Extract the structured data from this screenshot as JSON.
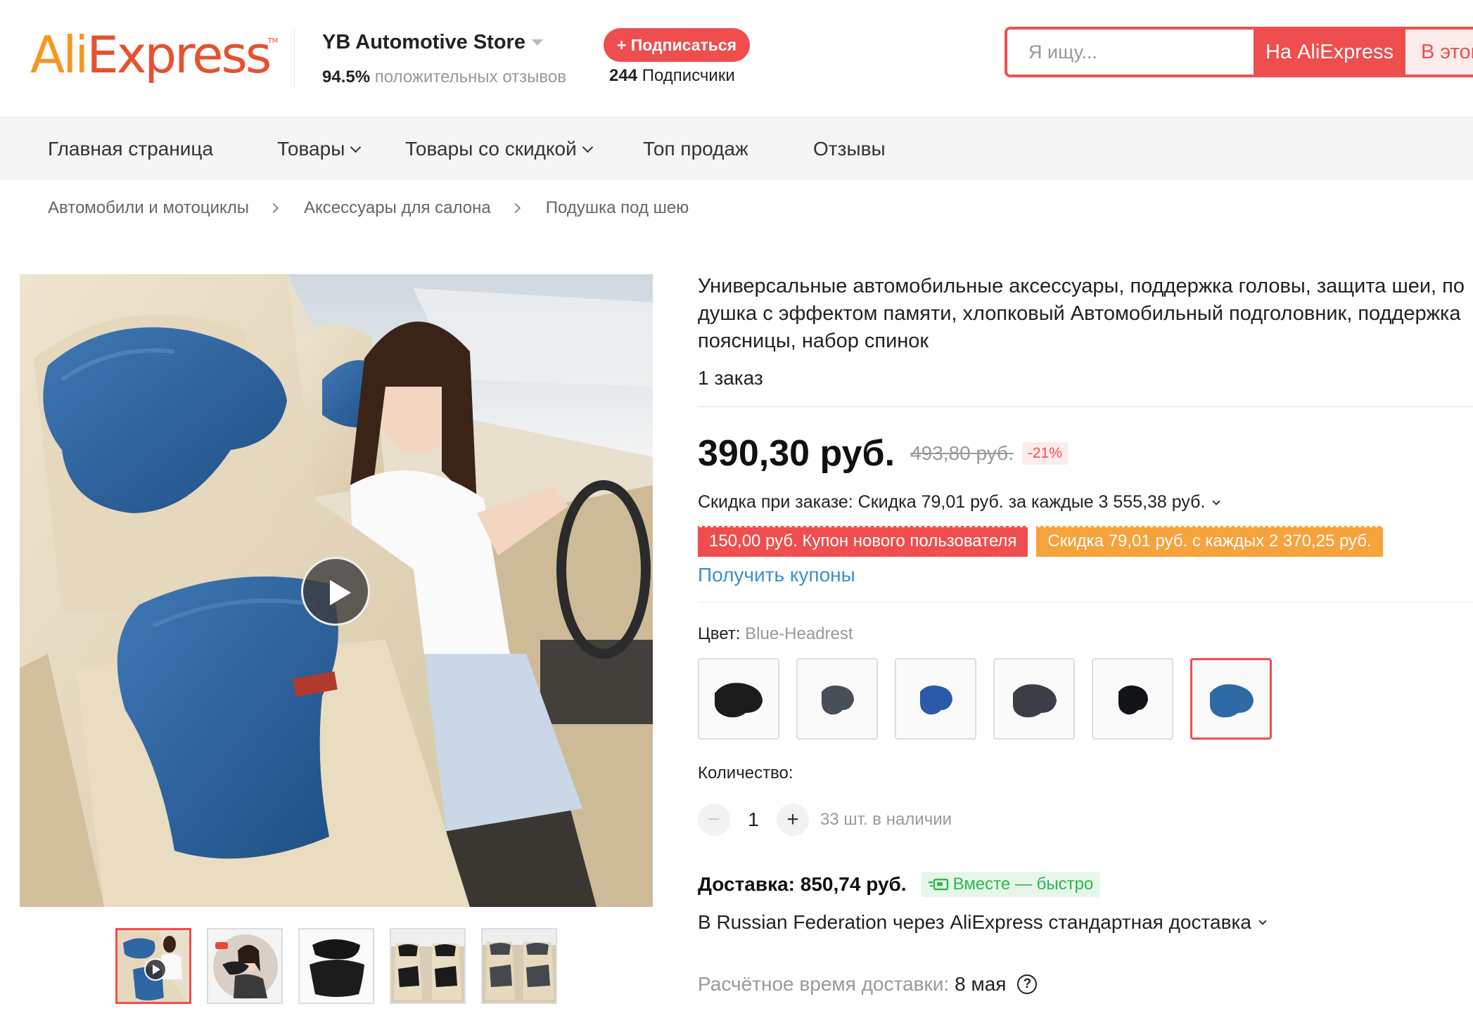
{
  "header": {
    "logo_ali": "Ali",
    "logo_express": "Express",
    "logo_tm": "TM",
    "store_name": "YB Automotive Store",
    "store_rating_value": "94.5%",
    "store_rating_text": "положительных отзывов",
    "follow_label": "+ Подписаться",
    "followers_count": "244",
    "followers_text": "Подписчики",
    "search_placeholder": "Я ищу...",
    "search_aliexpress_label": "На AliExpress",
    "search_store_label": "В этом"
  },
  "nav": {
    "items": [
      {
        "label": "Главная страница"
      },
      {
        "label": "Товары"
      },
      {
        "label": "Товары со скидкой"
      },
      {
        "label": "Топ продаж"
      },
      {
        "label": "Отзывы"
      }
    ]
  },
  "breadcrumbs": [
    "Автомобили и мотоциклы",
    "Аксессуары для салона",
    "Подушка под шею"
  ],
  "product": {
    "title": "Универсальные автомобильные аксессуары, поддержка головы, защита шеи, подушка с эффектом памяти, хлопковый Автомобильный подголовник, поддержка поясницы, набор спинок",
    "orders": "1 заказ",
    "price": "390,30 руб.",
    "old_price": "493,80 руб.",
    "discount": "-21%",
    "bulk_discount": "Скидка при заказе: Скидка 79,01 руб. за каждые 3 555,38 руб.",
    "coupons": [
      {
        "label": "150,00 руб. Купон нового пользователя",
        "color": "#f04e4e"
      },
      {
        "label": "Скидка 79,01 руб. с каждых 2 370,25 руб.",
        "color": "#f6a33b"
      }
    ],
    "get_coupons": "Получить купоны",
    "color_label": "Цвет:",
    "color_value": "Blue-Headrest",
    "swatches": [
      {
        "name": "black-headrest",
        "color": "#1c1c1c"
      },
      {
        "name": "gray-headrest",
        "color": "#4a4f57"
      },
      {
        "name": "blue-headrest-small",
        "color": "#2b5aa8"
      },
      {
        "name": "dark-gray-headrest",
        "color": "#3b3f45"
      },
      {
        "name": "black-headrest-small",
        "color": "#121418"
      },
      {
        "name": "blue-headrest",
        "color": "#2e6aa3",
        "selected": true
      }
    ],
    "quantity_label": "Количество:",
    "quantity": "1",
    "quantity_minus": "−",
    "quantity_plus": "+",
    "stock": "33 шт. в наличии",
    "shipping_cost": "Доставка: 850,74 руб.",
    "fast_badge": "Вместе — быстро",
    "shipping_method": "В Russian Federation через AliExpress стандартная доставка",
    "eta_label": "Расчётное время доставки:",
    "eta_date": "8 мая",
    "help_symbol": "?"
  },
  "gallery": {
    "thumbnails": [
      {
        "name": "video-thumb",
        "active": true
      },
      {
        "name": "woman-headrest-thumb"
      },
      {
        "name": "black-set-thumb"
      },
      {
        "name": "car-seats-dark-thumb"
      },
      {
        "name": "car-seats-gray-thumb"
      }
    ]
  },
  "colors": {
    "accent": "#f04e4e",
    "link": "#3c8fcf",
    "coupon_orange": "#f6a33b",
    "fast_green": "#2db84c"
  }
}
